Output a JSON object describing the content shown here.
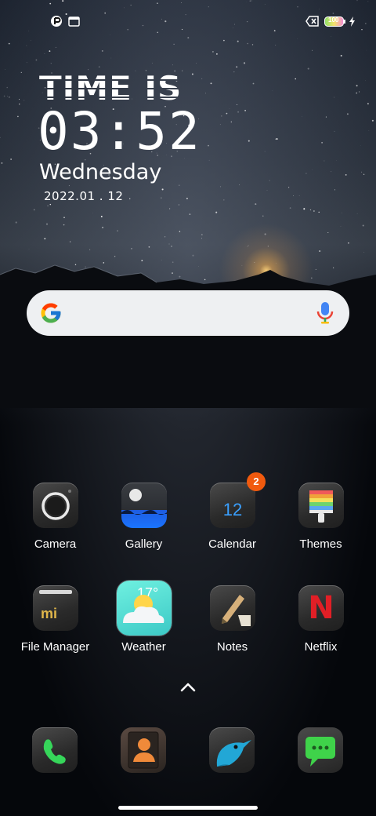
{
  "status_bar": {
    "left_icons": [
      "vpn-icon",
      "calendar-notification-icon"
    ],
    "calendar_icon_text": "1",
    "right_icons": [
      "no-sim-icon",
      "battery-icon",
      "charging-icon"
    ],
    "battery_level": "100"
  },
  "clock_widget": {
    "title": "TIME IS",
    "time": "03:52",
    "day": "Wednesday",
    "date": "2022.01 . 12"
  },
  "search_bar": {
    "icons": [
      "google-logo-icon",
      "microphone-icon"
    ]
  },
  "apps": [
    {
      "name": "camera",
      "label": "Camera"
    },
    {
      "name": "gallery",
      "label": "Gallery"
    },
    {
      "name": "calendar",
      "label": "Calendar",
      "tile_text": "12",
      "badge": "2"
    },
    {
      "name": "themes",
      "label": "Themes"
    },
    {
      "name": "file-manager",
      "label": "File Manager",
      "tile_text": "mi"
    },
    {
      "name": "weather",
      "label": "Weather",
      "tile_text": "17°"
    },
    {
      "name": "notes",
      "label": "Notes"
    },
    {
      "name": "netflix",
      "label": "Netflix",
      "tile_text": "N"
    }
  ],
  "dock": [
    {
      "name": "phone",
      "icon": "phone-icon"
    },
    {
      "name": "contacts",
      "icon": "contacts-icon"
    },
    {
      "name": "browser",
      "icon": "kingfisher-icon"
    },
    {
      "name": "messages",
      "icon": "message-icon"
    }
  ],
  "colors": {
    "badge": "#f15a0e",
    "calendar_text": "#3aa0ff",
    "search_bg": "#eef0f2"
  }
}
